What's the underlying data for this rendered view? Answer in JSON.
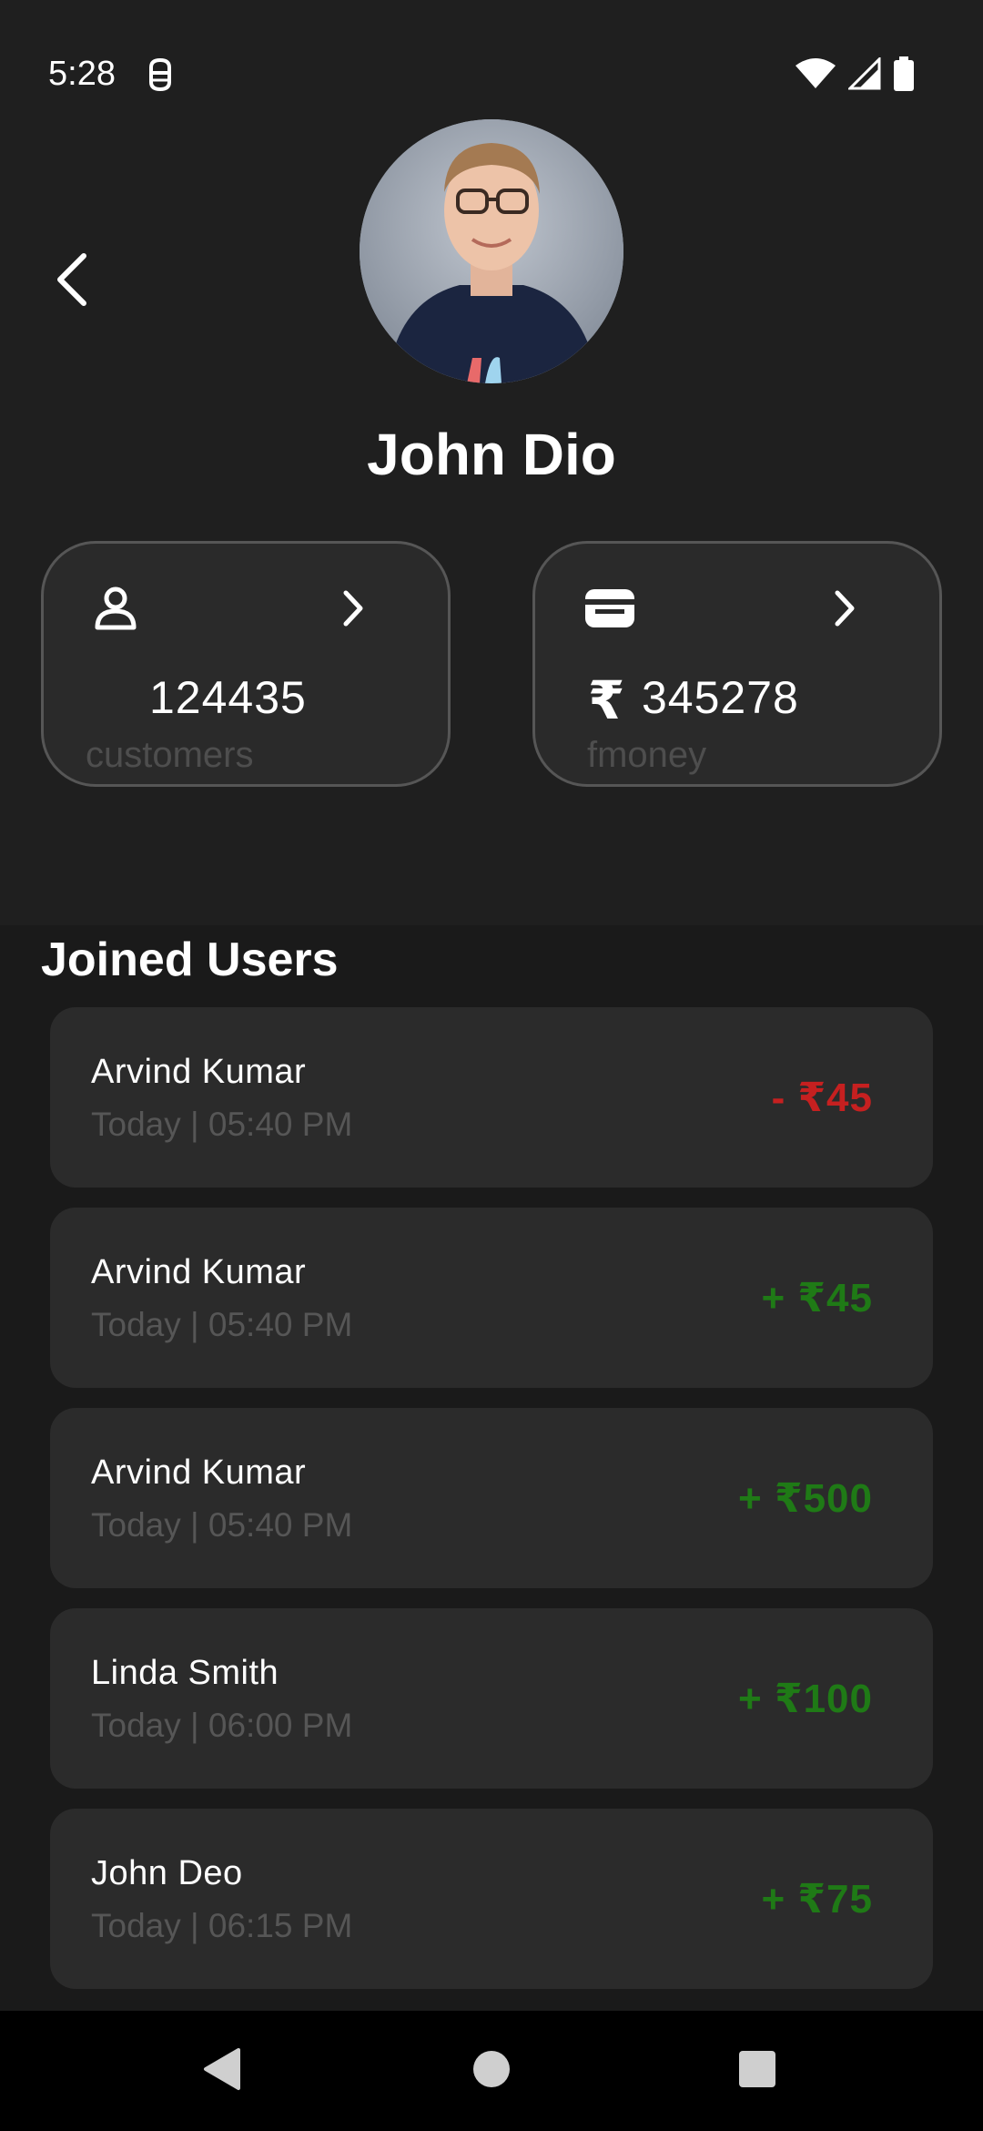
{
  "status_bar": {
    "time": "5:28",
    "icons": [
      "robot-icon",
      "wifi-icon",
      "cellular-signal-icon",
      "battery-icon"
    ]
  },
  "profile": {
    "name": "John Dio"
  },
  "cards": [
    {
      "icon": "person-icon",
      "value": "124435",
      "label": "customers"
    },
    {
      "icon": "wallet-icon",
      "currency": "₹",
      "value": "345278",
      "label": "fmoney"
    }
  ],
  "joined_users": {
    "title": "Joined Users",
    "items": [
      {
        "name": "Arvind Kumar",
        "time": "Today | 05:40 PM",
        "amount": "- ₹45",
        "type": "debit"
      },
      {
        "name": "Arvind Kumar",
        "time": "Today | 05:40 PM",
        "amount": "+ ₹45",
        "type": "credit"
      },
      {
        "name": "Arvind Kumar",
        "time": "Today | 05:40 PM",
        "amount": "+ ₹500",
        "type": "credit"
      },
      {
        "name": "Linda Smith",
        "time": "Today | 06:00 PM",
        "amount": "+ ₹100",
        "type": "credit"
      },
      {
        "name": "John Deo",
        "time": "Today | 06:15 PM",
        "amount": "+ ₹75",
        "type": "credit"
      }
    ]
  },
  "colors": {
    "background": "#1f1f1f",
    "card": "#2b2b2b",
    "debit": "#c62020",
    "credit": "#1f7a16",
    "muted_text": "#565656"
  }
}
